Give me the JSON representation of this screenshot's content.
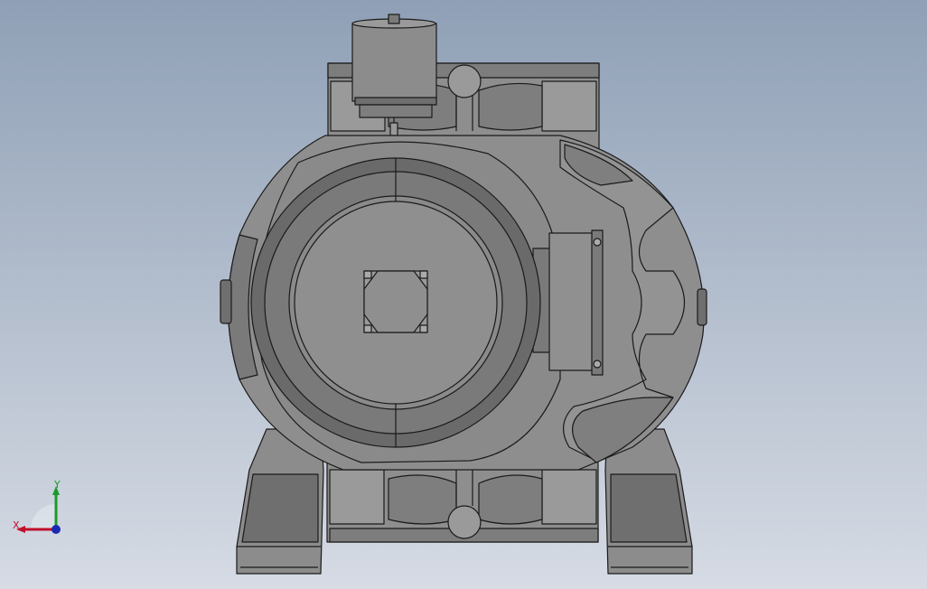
{
  "viewport": {
    "background_top": "#8fa0b6",
    "background_bottom": "#d6dbe4"
  },
  "model": {
    "body_color": "#8a8a8a",
    "edge_color": "#1a1a1a",
    "light_color": "#a8a8a8",
    "dark_color": "#6a6a6a"
  },
  "triad": {
    "x_label": "X",
    "y_label": "Y",
    "x_color": "#c0102a",
    "y_color": "#1a9a2a",
    "z_color": "#1a2ab0"
  }
}
